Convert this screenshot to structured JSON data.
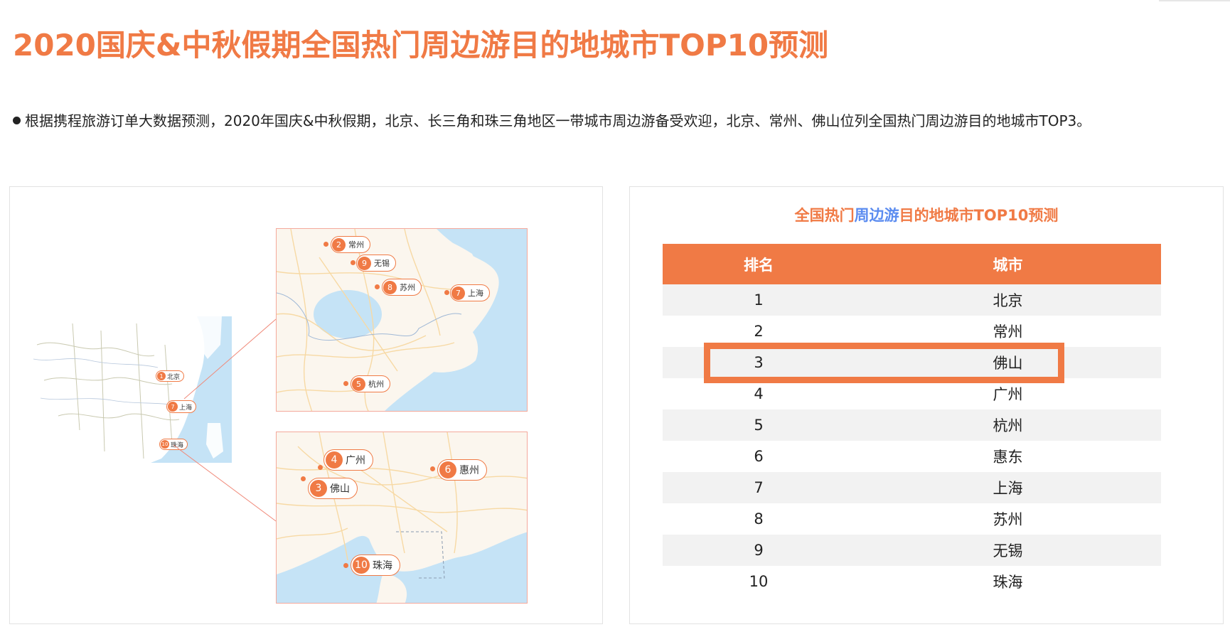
{
  "page": {
    "title": "2020国庆&中秋假期全国热门周边游目的地城市TOP10预测",
    "summary": "根据携程旅游订单大数据预测，2020年国庆&中秋假期，北京、长三角和珠三角地区一带城市周边游备受欢迎，北京、常州、佛山位列全国热门周边游目的地城市TOP3。"
  },
  "map": {
    "china_markers": [
      {
        "rank": "1",
        "city": "北京"
      },
      {
        "rank": "7",
        "city": "上海"
      },
      {
        "rank": "10",
        "city": "珠海"
      }
    ],
    "yangtze_markers": [
      {
        "rank": "2",
        "city": "常州"
      },
      {
        "rank": "9",
        "city": "无锡"
      },
      {
        "rank": "8",
        "city": "苏州"
      },
      {
        "rank": "7",
        "city": "上海"
      },
      {
        "rank": "5",
        "city": "杭州"
      }
    ],
    "pearl_markers": [
      {
        "rank": "4",
        "city": "广州"
      },
      {
        "rank": "6",
        "city": "惠州"
      },
      {
        "rank": "3",
        "city": "佛山"
      },
      {
        "rank": "10",
        "city": "珠海"
      }
    ]
  },
  "table": {
    "title_part1": "全国热门",
    "title_part2": "周边游",
    "title_part3": "目的地城市TOP10预测",
    "col_rank": "排名",
    "col_city": "城市",
    "rows": [
      {
        "rank": "1",
        "city": "北京"
      },
      {
        "rank": "2",
        "city": "常州"
      },
      {
        "rank": "3",
        "city": "佛山"
      },
      {
        "rank": "4",
        "city": "广州"
      },
      {
        "rank": "5",
        "city": "杭州"
      },
      {
        "rank": "6",
        "city": "惠东"
      },
      {
        "rank": "7",
        "city": "上海"
      },
      {
        "rank": "8",
        "city": "苏州"
      },
      {
        "rank": "9",
        "city": "无锡"
      },
      {
        "rank": "10",
        "city": "珠海"
      }
    ]
  },
  "colors": {
    "accent": "#f07a45",
    "highlight_text": "#5b8cf0",
    "water": "#c5e3f6",
    "land": "#fbf6ee",
    "road": "#f7d9a4"
  }
}
